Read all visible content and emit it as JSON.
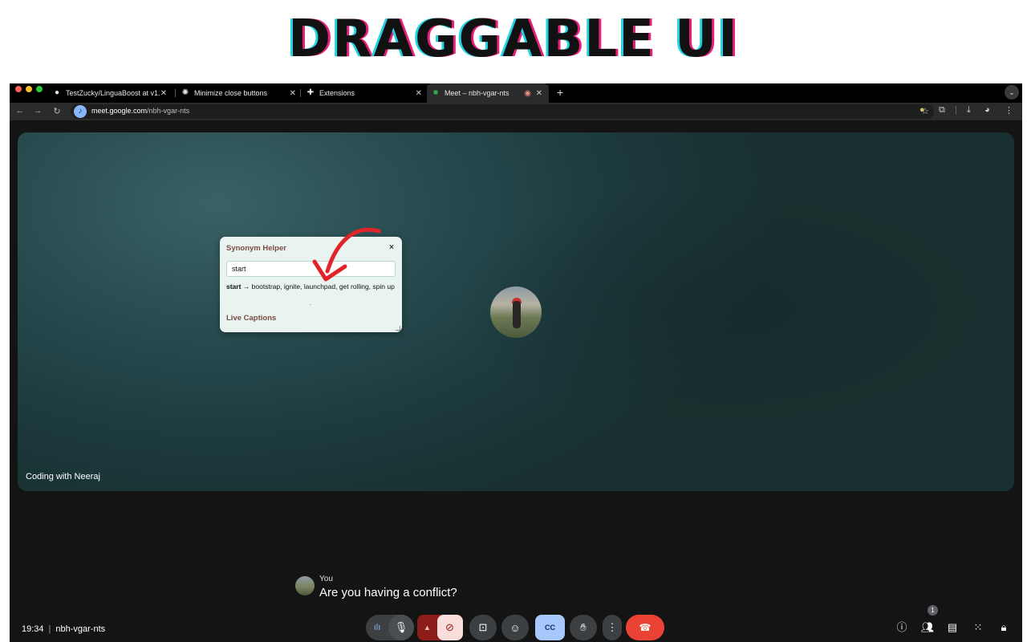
{
  "banner": {
    "title": "DRAGGABLE UI"
  },
  "browser": {
    "tabs": [
      {
        "title": "TestZucky/LinguaBoost at v1.",
        "icon": "github-icon"
      },
      {
        "title": "Minimize close buttons",
        "icon": "openai-icon"
      },
      {
        "title": "Extensions",
        "icon": "puzzle-icon"
      },
      {
        "title": "Meet – nbh-vgar-nts",
        "icon": "meet-icon",
        "active": true,
        "recording": true
      }
    ],
    "url_host": "meet.google.com",
    "url_path": "/nbh-vgar-nts"
  },
  "meet": {
    "participant_name": "Coding with Neeraj",
    "caption": {
      "speaker": "You",
      "text": "Are you having a conflict?"
    },
    "clock": "19:34",
    "meeting_code": "nbh-vgar-nts",
    "people_count": "1"
  },
  "helper": {
    "title": "Synonym Helper",
    "close": "×",
    "input_value": "start",
    "result_word": "start",
    "result_synonyms": " → bootstrap, ignite, launchpad, get rolling, spin up",
    "captions_label": "Live Captions"
  },
  "colors": {
    "accent_red": "#ea4335",
    "stage_teal": "#264a4e",
    "helper_bg": "#e9f4f1",
    "helper_title": "#7b4a42",
    "cc_active": "#a8c7fa",
    "arrow_red": "#e0252a"
  }
}
